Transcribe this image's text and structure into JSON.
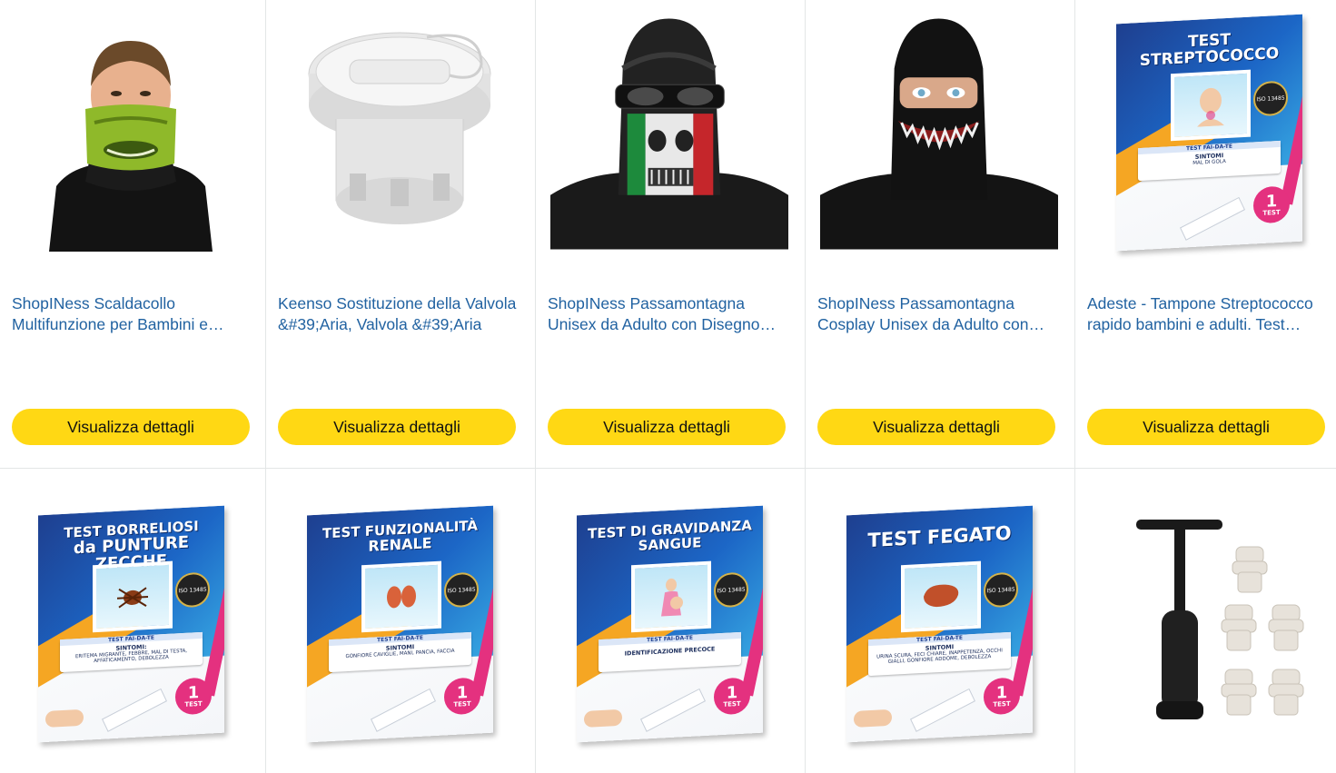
{
  "products": [
    {
      "title": "ShopINess Scaldacollo Multifunzione per Bambini e Adulto",
      "button": "Visualizza dettagli"
    },
    {
      "title": "Keenso Sostituzione della Valvola &#39;Aria, Valvola &#39;Aria",
      "button": "Visualizza dettagli"
    },
    {
      "title": "ShopINess Passamontagna Unisex da Adulto con Disegno Teschio",
      "button": "Visualizza dettagli"
    },
    {
      "title": "ShopINess Passamontagna Cosplay Unisex da Adulto con Maschera",
      "button": "Visualizza dettagli"
    },
    {
      "title": "Adeste - Tampone Streptococco rapido bambini e adulti. Test Streptococco",
      "button": "Visualizza dettagli"
    }
  ],
  "boxes": {
    "strep": {
      "heading": "TEST STREPTOCOCCO",
      "label_top": "TEST FAI-DA-TE",
      "label_mid": "SINTOMI",
      "label_text": "MAL DI GOLA",
      "iso": "ISO 13485",
      "badge_num": "1",
      "badge_txt": "TEST"
    },
    "borreliosi": {
      "heading_1": "TEST BORRELIOSI",
      "heading_2": "da PUNTURE ZECCHE",
      "label_top": "TEST FAI-DA-TE",
      "label_mid": "SINTOMI:",
      "label_text": "ERITEMA MIGRANTE, FEBBRE, MAL DI TESTA, AFFATICAMENTO, DEBOLEZZA",
      "iso": "ISO 13485",
      "badge_num": "1",
      "badge_txt": "TEST"
    },
    "renale": {
      "heading_1": "TEST FUNZIONALITÀ",
      "heading_2": "RENALE",
      "label_top": "TEST FAI-DA-TE",
      "label_mid": "SINTOMI",
      "label_text": "GONFIORE CAVIGLIE, MANI, PANCIA, FACCIA",
      "iso": "ISO 13485",
      "badge_num": "1",
      "badge_txt": "TEST"
    },
    "gravidanza": {
      "heading_1": "TEST DI GRAVIDANZA",
      "heading_2": "SANGUE",
      "label_top": "TEST FAI-DA-TE",
      "label_mid": "IDENTIFICAZIONE PRECOCE",
      "label_text": "",
      "iso": "ISO 13485",
      "badge_num": "1",
      "badge_txt": "TEST"
    },
    "fegato": {
      "heading_1": "TEST FEGATO",
      "label_top": "TEST FAI-DA-TE",
      "label_mid": "SINTOMI",
      "label_text": "URINA SCURA, FECI CHIARE, INAPPETENZA, OCCHI GIALLI, GONFIORE ADDOME, DEBOLEZZA",
      "iso": "ISO 13485",
      "badge_num": "1",
      "badge_txt": "TEST"
    }
  },
  "colors": {
    "link": "#2162a1",
    "button": "#ffd814",
    "divider": "#e3e6e6"
  }
}
